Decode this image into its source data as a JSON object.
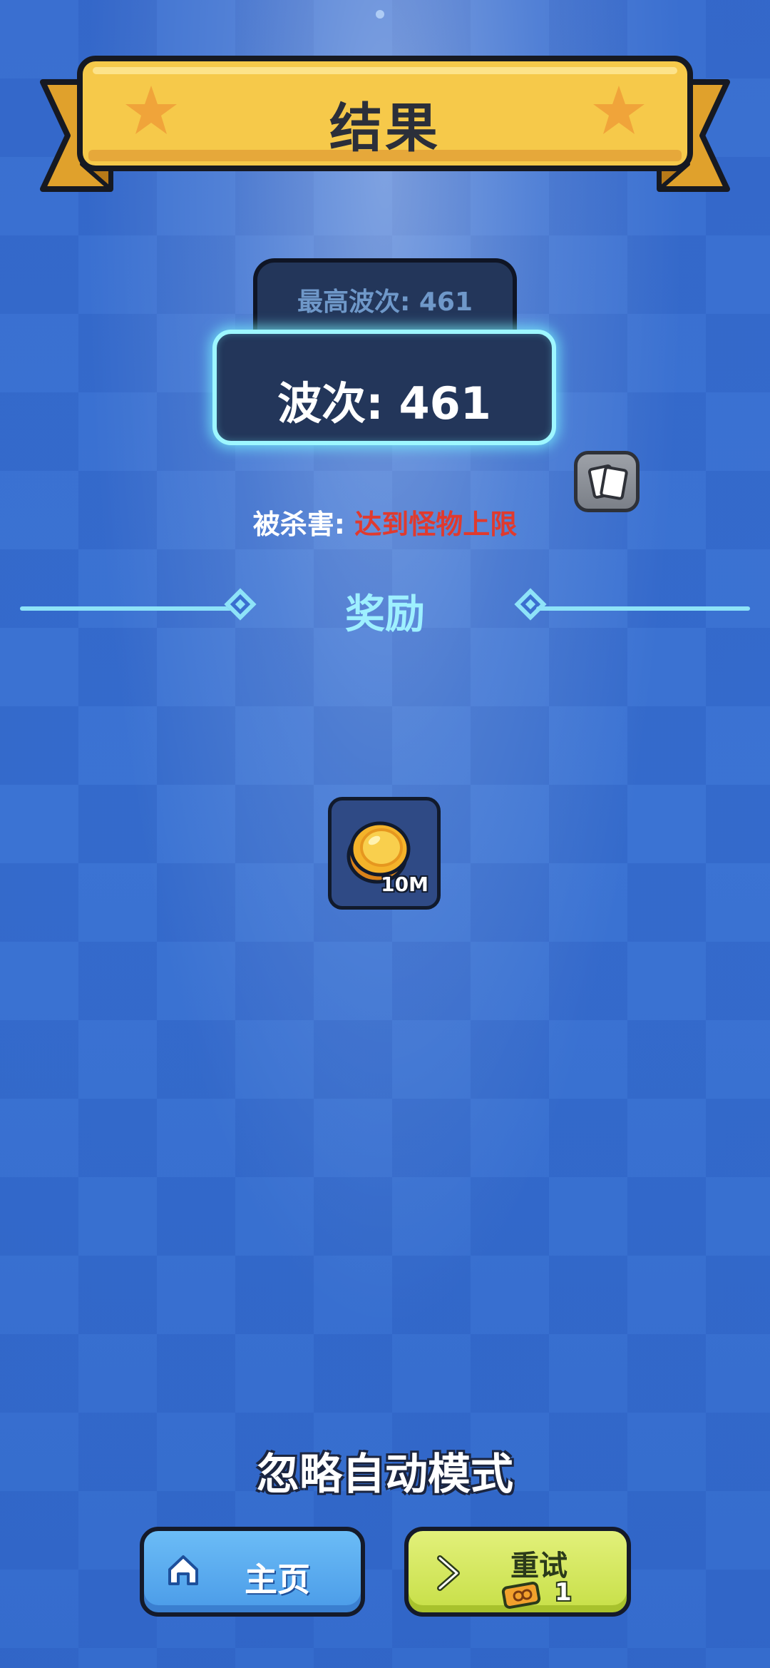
{
  "header": {
    "title": "结果"
  },
  "stats": {
    "best_wave_label": "最高波次: 461",
    "wave_label": "波次: 461"
  },
  "death": {
    "prefix": "被杀害: ",
    "reason": "达到怪物上限"
  },
  "rewards": {
    "title": "奖励",
    "items": [
      {
        "icon": "coin-icon",
        "amount": "10M"
      }
    ]
  },
  "footer": {
    "ignore_auto_label": "忽略自动模式",
    "home_label": "主页",
    "retry_label": "重试",
    "retry_ticket_count": "1"
  },
  "colors": {
    "background": "#3a6fd0",
    "banner_yellow": "#f6c94a",
    "panel_dark": "#23365a",
    "glow_cyan": "#9ef7ff",
    "rewards_cyan": "#9ef0ff",
    "reason_red": "#e03a2e",
    "home_blue": "#4a9be8",
    "retry_green": "#c7df47"
  }
}
